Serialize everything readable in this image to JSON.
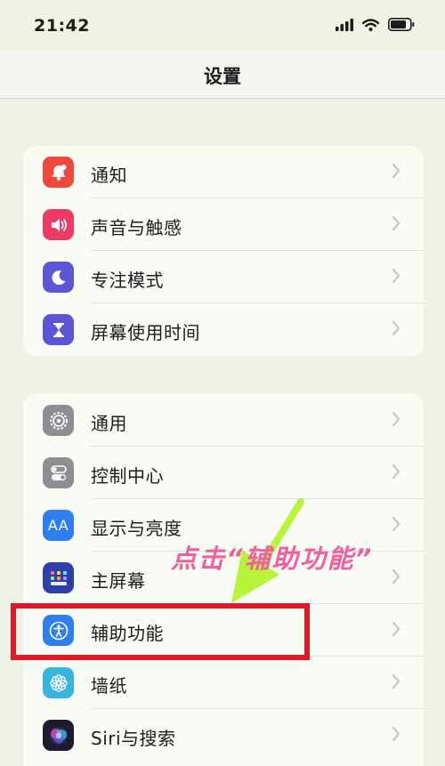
{
  "status_bar": {
    "time": "21:42"
  },
  "nav": {
    "title": "设置"
  },
  "group1": [
    {
      "label": "通知",
      "icon": "bell-icon",
      "color": "#f0473c"
    },
    {
      "label": "声音与触感",
      "icon": "speaker-icon",
      "color": "#ee3b64"
    },
    {
      "label": "专注模式",
      "icon": "moon-icon",
      "color": "#5c56d6"
    },
    {
      "label": "屏幕使用时间",
      "icon": "hourglass-icon",
      "color": "#5c56d6"
    }
  ],
  "group2": [
    {
      "label": "通用",
      "icon": "gear-icon",
      "color": "#8e8e93"
    },
    {
      "label": "控制中心",
      "icon": "toggles-icon",
      "color": "#8e8e93"
    },
    {
      "label": "显示与亮度",
      "icon": "aa-icon",
      "icon_text": "AA",
      "color": "#2d7ff0"
    },
    {
      "label": "主屏幕",
      "icon": "home-grid-icon",
      "color": "#2e3fa8"
    },
    {
      "label": "辅助功能",
      "icon": "accessibility-icon",
      "color": "#2d7ff0"
    },
    {
      "label": "墙纸",
      "icon": "flower-icon",
      "color": "#35b6de"
    },
    {
      "label": "Siri与搜索",
      "icon": "siri-icon",
      "color": "#1c1c2e"
    }
  ],
  "annotation": {
    "text": "点击“辅助功能”",
    "text_color": "#f25f9d",
    "box_color": "#e0192a",
    "arrow_color": "#b8f53a"
  }
}
